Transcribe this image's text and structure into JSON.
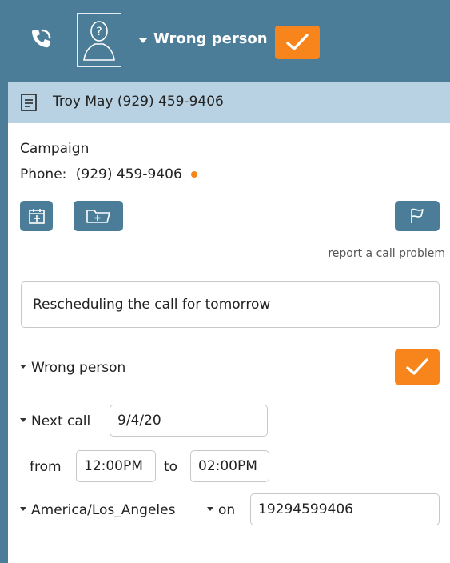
{
  "header": {
    "disposition_label": "Wrong person"
  },
  "contact": {
    "summary": "Troy May (929) 459-9406"
  },
  "details": {
    "campaign_label": "Campaign",
    "phone_label": "Phone:",
    "phone_value": "(929) 459-9406"
  },
  "links": {
    "report_problem": "report a call problem"
  },
  "note": {
    "value": "Rescheduling the call for tomorrow"
  },
  "disposition": {
    "label": "Wrong person"
  },
  "schedule": {
    "next_call_label": "Next call",
    "next_call_date": "9/4/20",
    "from_label": "from",
    "from_time": "12:00PM",
    "to_label": "to",
    "to_time": "02:00PM",
    "timezone": "America/Los_Angeles",
    "on_label": "on",
    "on_number": "19294599406"
  },
  "colors": {
    "header_bg": "#4b7d99",
    "contact_bar_bg": "#b8d2e3",
    "accent": "#f7851c"
  }
}
